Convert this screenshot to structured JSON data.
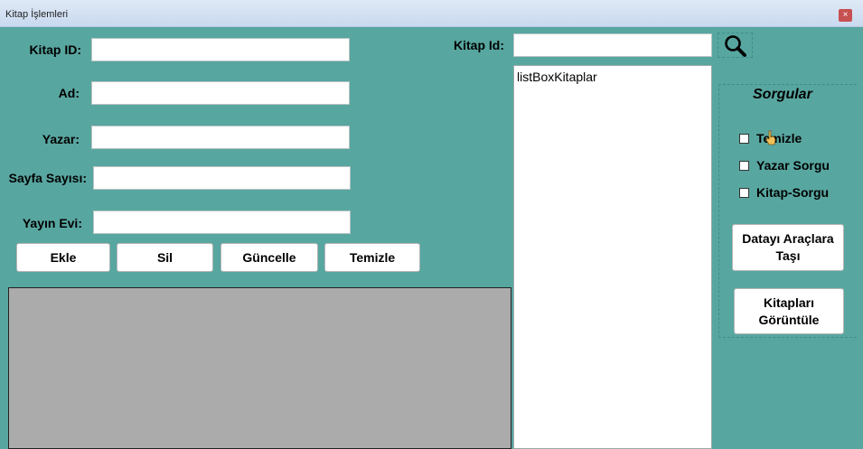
{
  "window": {
    "title": "Kitap İşlemleri",
    "close_glyph": "×",
    "background_color": "#58a6a0"
  },
  "form": {
    "kitap_id_label": "Kitap ID:",
    "ad_label": "Ad:",
    "yazar_label": "Yazar:",
    "sayfa_sayisi_label": "Sayfa Sayısı:",
    "yayin_evi_label": "Yayın Evi:",
    "kitap_id_value": "",
    "ad_value": "",
    "yazar_value": "",
    "sayfa_sayisi_value": "",
    "yayin_evi_value": ""
  },
  "buttons": {
    "ekle": "Ekle",
    "sil": "Sil",
    "guncelle": "Güncelle",
    "temizle": "Temizle"
  },
  "search": {
    "label": "Kitap Id:",
    "value": "",
    "icon": "magnifier-icon"
  },
  "listbox": {
    "item": "listBoxKitaplar"
  },
  "sorgular": {
    "title": "Sorgular",
    "checkboxes": [
      {
        "label": "Temizle",
        "checked": false
      },
      {
        "label": "Yazar Sorgu",
        "checked": false
      },
      {
        "label": "Kitap-Sorgu",
        "checked": false
      }
    ],
    "move_button_line1": "Datayı Araçlara",
    "move_button_line2": "Taşı",
    "view_button_line1": "Kitapları",
    "view_button_line2": "Görüntüle"
  }
}
